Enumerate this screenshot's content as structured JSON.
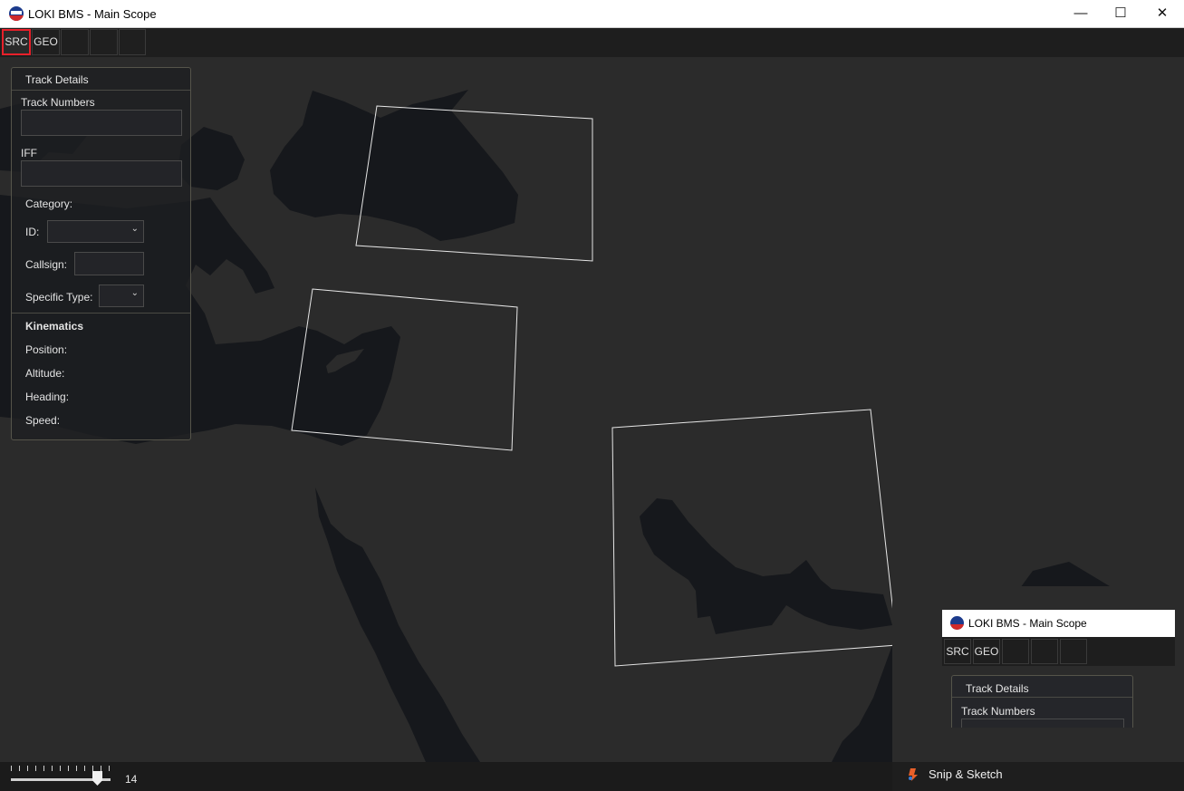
{
  "window": {
    "title": "LOKI BMS - Main Scope",
    "minimize_symbol": "—",
    "maximize_symbol": "☐",
    "close_symbol": "✕"
  },
  "toolbar": {
    "buttons": [
      {
        "label": "SRC",
        "active": true
      },
      {
        "label": "GEO",
        "active": false
      },
      {
        "label": "",
        "active": false
      },
      {
        "label": "",
        "active": false
      },
      {
        "label": "",
        "active": false
      }
    ]
  },
  "track_panel": {
    "header": "Track Details",
    "track_numbers_label": "Track Numbers",
    "track_numbers_value": "",
    "iff_label": "IFF",
    "iff_value": "",
    "category_label": "Category:",
    "id_label": "ID:",
    "id_value": "",
    "callsign_label": "Callsign:",
    "callsign_value": "",
    "specific_type_label": "Specific Type:",
    "specific_type_value": "",
    "kinematics_header": "Kinematics",
    "position_label": "Position:",
    "altitude_label": "Altitude:",
    "heading_label": "Heading:",
    "speed_label": "Speed:"
  },
  "zoom": {
    "value": "14"
  },
  "snip_preview": {
    "title": "LOKI BMS - Main Scope",
    "toolbar_buttons": [
      "SRC",
      "GEO",
      "",
      "",
      ""
    ],
    "panel_header": "Track Details",
    "panel_label": "Track Numbers"
  },
  "notification": {
    "text": "Snip & Sketch"
  },
  "colors": {
    "map_background": "#2b2b2b",
    "water": "#16181c",
    "zone_outline": "#e6e6e6",
    "active_highlight": "#e8202a"
  }
}
